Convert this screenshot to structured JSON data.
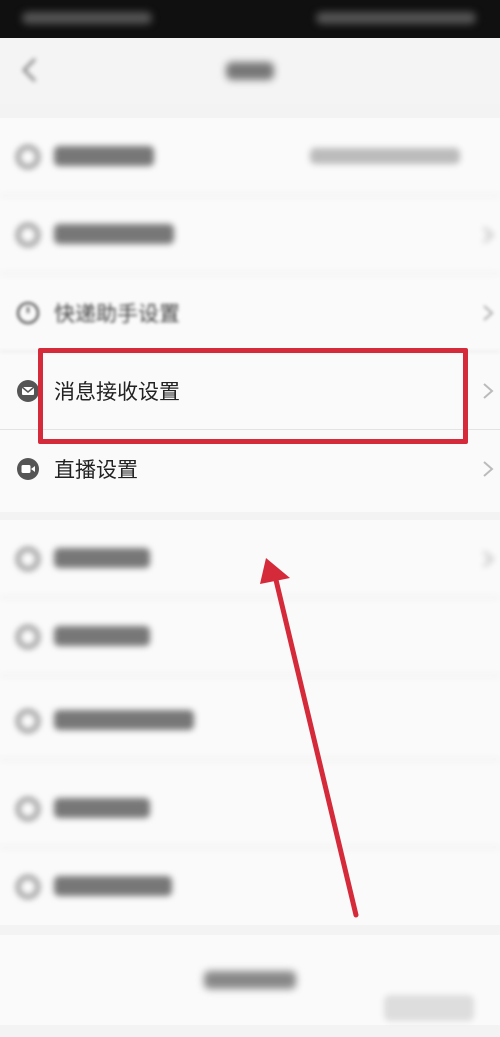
{
  "status_bar": {
    "left_text": "",
    "right_text": ""
  },
  "nav": {
    "title": "",
    "back_icon": "chevron-left-icon"
  },
  "settings_group_1": [
    {
      "label": "",
      "icon": "circle-icon",
      "value": "",
      "blurred": true
    },
    {
      "label": "",
      "icon": "circle-icon",
      "value": "",
      "blurred": true
    },
    {
      "label": "快递助手设置",
      "icon": "clock-icon",
      "value": "",
      "blurred": false
    },
    {
      "label": "消息接收设置",
      "icon": "message-icon",
      "value": "",
      "blurred": false
    },
    {
      "label": "直播设置",
      "icon": "video-icon",
      "value": "",
      "blurred": false
    }
  ],
  "settings_group_2": [
    {
      "label": "",
      "icon": "circle-icon",
      "blurred": true
    },
    {
      "label": "",
      "icon": "circle-icon",
      "blurred": true
    },
    {
      "label": "",
      "icon": "circle-icon",
      "blurred": true
    },
    {
      "label": "",
      "icon": "circle-icon",
      "blurred": true
    },
    {
      "label": "",
      "icon": "circle-icon",
      "blurred": true
    }
  ],
  "logout": {
    "label": ""
  },
  "annotation": {
    "highlight_color": "#d42a3a",
    "arrow_color": "#d42a3a"
  },
  "watermark": {
    "text": ""
  }
}
